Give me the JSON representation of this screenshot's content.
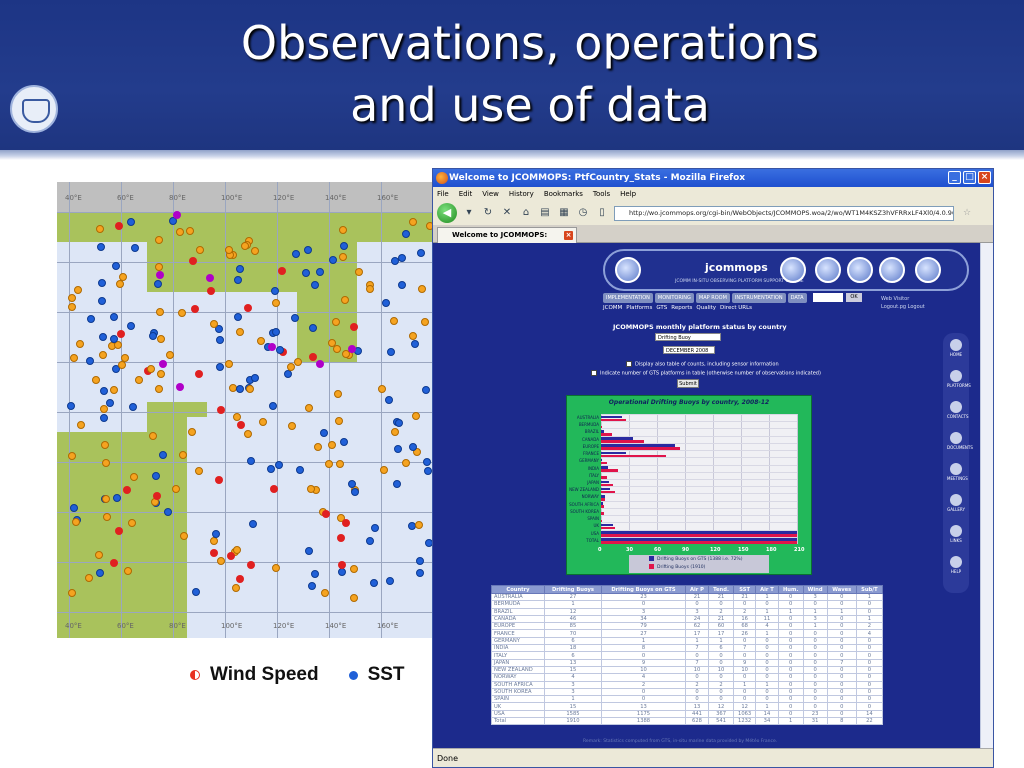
{
  "slide": {
    "title_line1": "Observations, operations",
    "title_line2": "and use of data"
  },
  "map": {
    "lon_labels": [
      "40°E",
      "60°E",
      "80°E",
      "100°E",
      "120°E",
      "140°E",
      "160°E"
    ]
  },
  "legend": {
    "wind_speed": "Wind Speed",
    "sst": "SST"
  },
  "browser": {
    "title": "Welcome to JCOMMOPS: PtfCountry_Stats - Mozilla Firefox",
    "menu": [
      "File",
      "Edit",
      "View",
      "History",
      "Bookmarks",
      "Tools",
      "Help"
    ],
    "url": "http://wo.jcommops.org/cgi-bin/WebObjects/JCOMMOPS.woa/2/wo/WT1M4KSZ3hVFRRxLF4Xl0/4.0.96.2",
    "tab_label": "Welcome to JCOMMOPS: PtfCoun...",
    "status": "Done"
  },
  "jcommops": {
    "logo_text": "jcommops",
    "subtitle": "JCOMM IN-SITU OBSERVING PLATFORM SUPPORT CENTRE",
    "menu": [
      "IMPLEMENTATION",
      "MONITORING",
      "MAP ROOM",
      "INSTRUMENTATION",
      "DATA"
    ],
    "ok_label": "OK",
    "submenu": [
      "JCOMM",
      "Platforms",
      "GTS",
      "Reports",
      "Quality",
      "Direct URLs"
    ],
    "login_line1": "Web Visitor",
    "login_line2": "Logout.pg  Logout",
    "sidenav": [
      "HOME",
      "PLATFORMS",
      "CONTACTS",
      "DOCUMENTS",
      "MEETINGS",
      "GALLERY",
      "LINKS",
      "HELP"
    ],
    "form_title": "JCOMMOPS monthly platform status by country",
    "platform_select": "Drifting Buoy",
    "date_select": "DECEMBER 2008",
    "check1": "Display also table of counts, including sensor information",
    "check2": "Indicate number of GTS platforms in table (otherwise number of observations indicated)",
    "submit": "Submit",
    "footer": "Remark: Statistics computed from GTS, in-situ marine data provided by Météo France."
  },
  "chart_data": {
    "type": "bar",
    "title": "Operational Drifting Buoys by country, 2008-12",
    "categories": [
      "AUSTRALIA",
      "BERMUDA",
      "BRAZIL",
      "CANADA",
      "EUROPE",
      "FRANCE",
      "GERMANY",
      "INDIA",
      "ITALY",
      "JAPAN",
      "NEW ZEALAND",
      "NORWAY",
      "SOUTH AFRICA",
      "SOUTH KOREA",
      "SPAIN",
      "UK",
      "USA",
      "TOTAL"
    ],
    "series": [
      {
        "name": "Drifting Buoys on GTS (1388 i.e. 72%)",
        "values": [
          23,
          0,
          3,
          34,
          79,
          27,
          1,
          8,
          0,
          9,
          10,
          4,
          2,
          0,
          0,
          13,
          1175,
          1388
        ]
      },
      {
        "name": "Drifting Buoys (1910)",
        "values": [
          27,
          1,
          12,
          46,
          85,
          70,
          6,
          18,
          6,
          13,
          15,
          4,
          3,
          3,
          1,
          15,
          1585,
          1910
        ]
      }
    ],
    "x_ticks": [
      "0",
      "30",
      "60",
      "90",
      "120",
      "150",
      "180",
      "210"
    ],
    "xlim": [
      0,
      210
    ],
    "colors": {
      "s1": "#2a2aa0",
      "s2": "#e0144a"
    }
  },
  "table": {
    "headers": [
      "Country",
      "Drifting Buoys",
      "Drifting Buoys on GTS",
      "Air P",
      "Tend.",
      "SST",
      "Air T",
      "Hum.",
      "Wind",
      "Waves",
      "Sub/T"
    ],
    "rows": [
      [
        "AUSTRALIA",
        "27",
        "23",
        "21",
        "21",
        "21",
        "1",
        "0",
        "3",
        "0",
        "1"
      ],
      [
        "BERMUDA",
        "1",
        "0",
        "0",
        "0",
        "0",
        "0",
        "0",
        "0",
        "0",
        "0"
      ],
      [
        "BRAZIL",
        "12",
        "3",
        "3",
        "2",
        "2",
        "1",
        "1",
        "1",
        "1",
        "0"
      ],
      [
        "CANADA",
        "46",
        "34",
        "24",
        "21",
        "16",
        "11",
        "0",
        "3",
        "0",
        "1"
      ],
      [
        "EUROPE",
        "85",
        "79",
        "62",
        "60",
        "68",
        "4",
        "0",
        "1",
        "0",
        "2"
      ],
      [
        "FRANCE",
        "70",
        "27",
        "17",
        "17",
        "26",
        "1",
        "0",
        "0",
        "0",
        "4"
      ],
      [
        "GERMANY",
        "6",
        "1",
        "1",
        "1",
        "0",
        "0",
        "0",
        "0",
        "0",
        "0"
      ],
      [
        "INDIA",
        "18",
        "8",
        "7",
        "6",
        "7",
        "0",
        "0",
        "0",
        "0",
        "0"
      ],
      [
        "ITALY",
        "6",
        "0",
        "0",
        "0",
        "0",
        "0",
        "0",
        "0",
        "0",
        "0"
      ],
      [
        "JAPAN",
        "13",
        "9",
        "7",
        "0",
        "9",
        "0",
        "0",
        "0",
        "7",
        "0"
      ],
      [
        "NEW ZEALAND",
        "15",
        "10",
        "10",
        "10",
        "10",
        "0",
        "0",
        "0",
        "0",
        "0"
      ],
      [
        "NORWAY",
        "4",
        "4",
        "0",
        "0",
        "0",
        "0",
        "0",
        "0",
        "0",
        "0"
      ],
      [
        "SOUTH AFRICA",
        "3",
        "2",
        "2",
        "2",
        "1",
        "1",
        "0",
        "0",
        "0",
        "0"
      ],
      [
        "SOUTH KOREA",
        "3",
        "0",
        "0",
        "0",
        "0",
        "0",
        "0",
        "0",
        "0",
        "0"
      ],
      [
        "SPAIN",
        "1",
        "0",
        "0",
        "0",
        "0",
        "0",
        "0",
        "0",
        "0",
        "0"
      ],
      [
        "UK",
        "15",
        "13",
        "13",
        "12",
        "12",
        "1",
        "0",
        "0",
        "0",
        "0"
      ],
      [
        "USA",
        "1585",
        "1175",
        "441",
        "367",
        "1063",
        "14",
        "0",
        "23",
        "0",
        "14"
      ],
      [
        "Total",
        "1910",
        "1388",
        "628",
        "541",
        "1232",
        "34",
        "1",
        "31",
        "8",
        "22"
      ]
    ]
  }
}
